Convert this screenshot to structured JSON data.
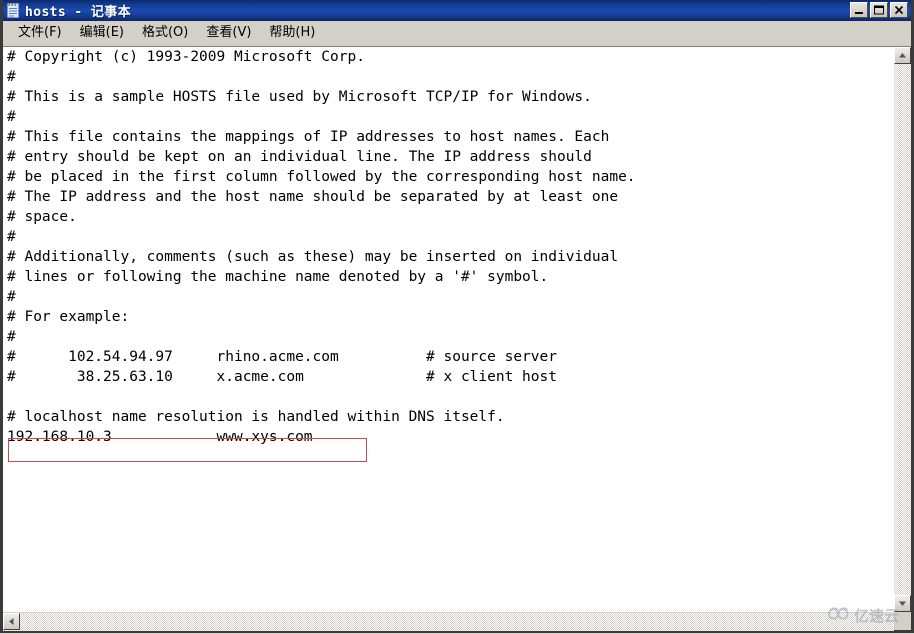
{
  "window": {
    "title": "hosts - 记事本",
    "icon": "notepad-icon",
    "buttons": {
      "minimize": "最小化",
      "maximize": "最大化",
      "close": "关闭"
    }
  },
  "menubar": {
    "items": [
      {
        "label": "文件(F)",
        "name": "menu-file"
      },
      {
        "label": "编辑(E)",
        "name": "menu-edit"
      },
      {
        "label": "格式(O)",
        "name": "menu-format"
      },
      {
        "label": "查看(V)",
        "name": "menu-view"
      },
      {
        "label": "帮助(H)",
        "name": "menu-help"
      }
    ]
  },
  "editor": {
    "lines": [
      "# Copyright (c) 1993-2009 Microsoft Corp.",
      "#",
      "# This is a sample HOSTS file used by Microsoft TCP/IP for Windows.",
      "#",
      "# This file contains the mappings of IP addresses to host names. Each",
      "# entry should be kept on an individual line. The IP address should",
      "# be placed in the first column followed by the corresponding host name.",
      "# The IP address and the host name should be separated by at least one",
      "# space.",
      "#",
      "# Additionally, comments (such as these) may be inserted on individual",
      "# lines or following the machine name denoted by a '#' symbol.",
      "#",
      "# For example:",
      "#",
      "#      102.54.94.97     rhino.acme.com          # source server",
      "#       38.25.63.10     x.acme.com              # x client host",
      "",
      "# localhost name resolution is handled within DNS itself.",
      "192.168.10.3            www.xys.com"
    ],
    "highlight": {
      "name": "red-annotation-box",
      "target_line": "192.168.10.3            www.xys.com",
      "color": "#d04a4a"
    }
  },
  "scrollbars": {
    "vertical": {
      "up_arrow": "▲",
      "down_arrow": "▼"
    },
    "horizontal": {
      "left_arrow": "◄",
      "right_arrow": "►"
    }
  },
  "watermark": {
    "text": "亿速云",
    "icon": "cloud-logo-icon",
    "color": "#9aa3ad"
  }
}
